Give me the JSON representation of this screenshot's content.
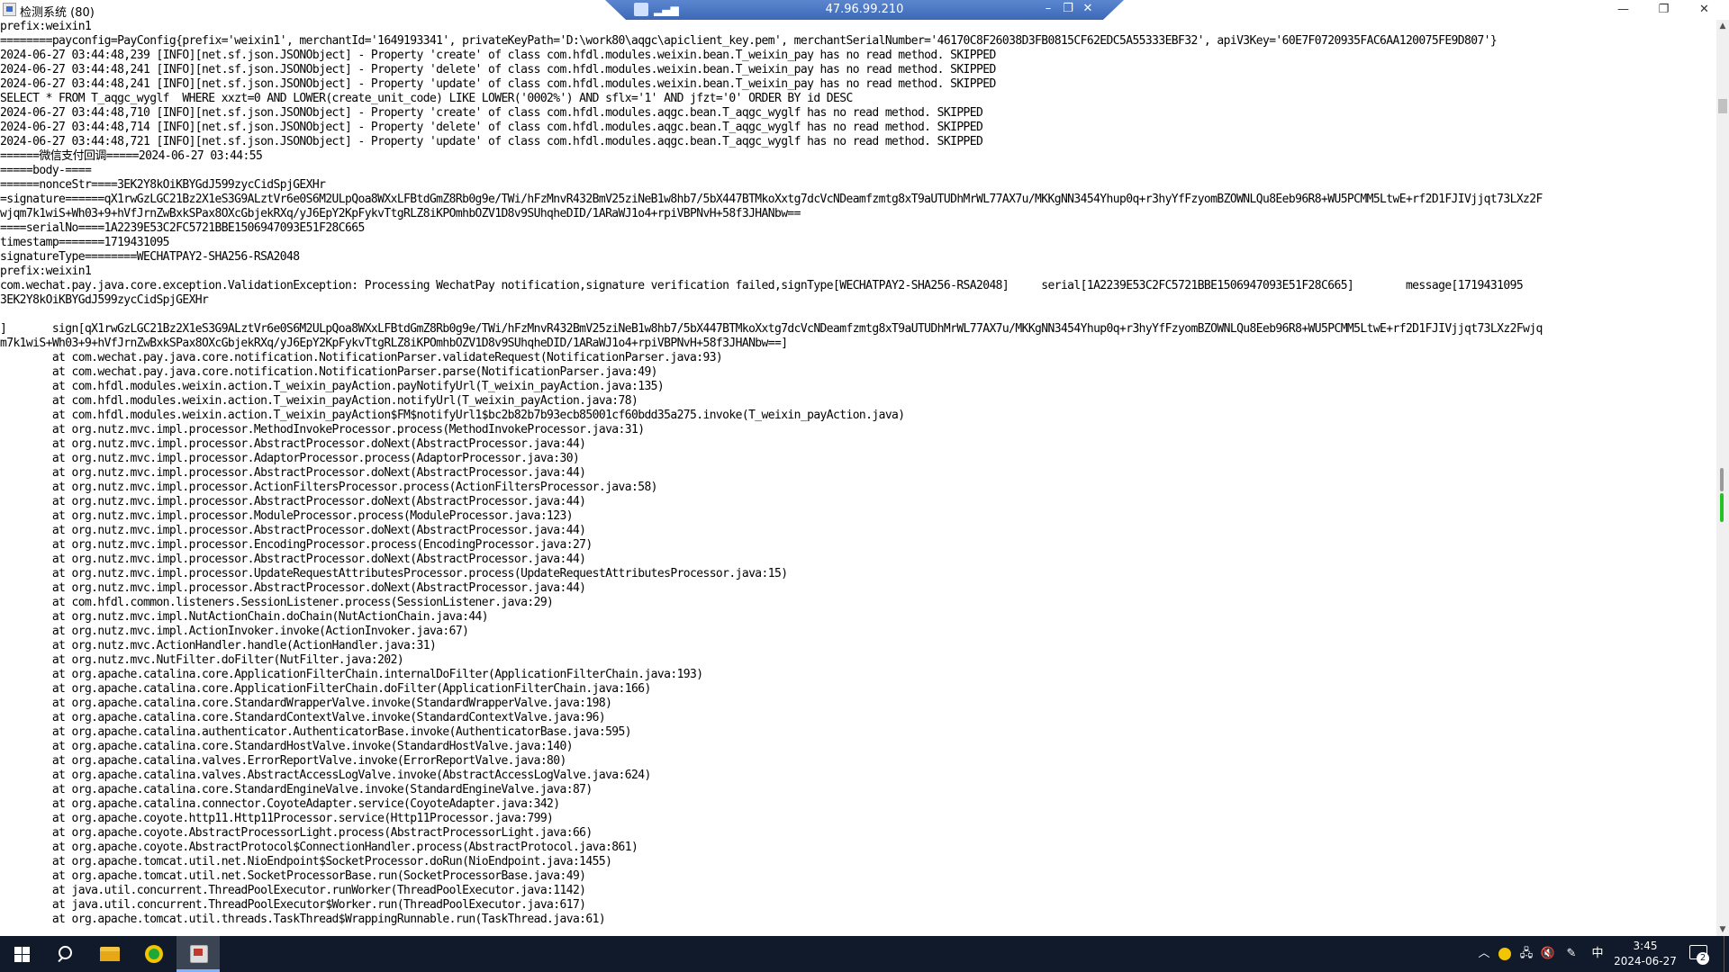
{
  "window": {
    "title": "检测系统 (80)",
    "minimize_icon": "minimize-icon",
    "maximize_icon": "restore-icon",
    "close_icon": "close-icon",
    "minimize_glyph": "—",
    "restore_glyph": "❐",
    "close_glyph": "✕"
  },
  "remote_bar": {
    "host": "47.96.99.210",
    "signal_glyph": "▂▄▆",
    "minimize_glyph": "–",
    "restore_glyph": "❐",
    "close_glyph": "✕"
  },
  "console": {
    "lines": [
      "prefix:weixin1",
      "========payconfig=PayConfig{prefix='weixin1', merchantId='1649193341', privateKeyPath='D:\\work80\\aqgc\\apiclient_key.pem', merchantSerialNumber='46170C8F26038D3FB0815CF62EDC5A55333EBF32', apiV3Key='60E7F0720935FAC6AA120075FE9D807'}",
      "2024-06-27 03:44:48,239 [INFO][net.sf.json.JSONObject] - Property 'create' of class com.hfdl.modules.weixin.bean.T_weixin_pay has no read method. SKIPPED",
      "2024-06-27 03:44:48,241 [INFO][net.sf.json.JSONObject] - Property 'delete' of class com.hfdl.modules.weixin.bean.T_weixin_pay has no read method. SKIPPED",
      "2024-06-27 03:44:48,241 [INFO][net.sf.json.JSONObject] - Property 'update' of class com.hfdl.modules.weixin.bean.T_weixin_pay has no read method. SKIPPED",
      "SELECT * FROM T_aqgc_wyglf  WHERE xxzt=0 AND LOWER(create_unit_code) LIKE LOWER('0002%') AND sflx='1' AND jfzt='0' ORDER BY id DESC",
      "2024-06-27 03:44:48,710 [INFO][net.sf.json.JSONObject] - Property 'create' of class com.hfdl.modules.aqgc.bean.T_aqgc_wyglf has no read method. SKIPPED",
      "2024-06-27 03:44:48,714 [INFO][net.sf.json.JSONObject] - Property 'delete' of class com.hfdl.modules.aqgc.bean.T_aqgc_wyglf has no read method. SKIPPED",
      "2024-06-27 03:44:48,721 [INFO][net.sf.json.JSONObject] - Property 'update' of class com.hfdl.modules.aqgc.bean.T_aqgc_wyglf has no read method. SKIPPED",
      "======微信支付回调=====2024-06-27 03:44:55",
      "=====body-====",
      "======nonceStr====3EK2Y8kOiKBYGdJ599zycCidSpjGEXHr",
      "=signature======qX1rwGzLGC21Bz2X1eS3G9ALztVr6e0S6M2ULpQoa8WXxLFBtdGmZ8Rb0g9e/TWi/hFzMnvR432BmV25ziNeB1w8hb7/5bX447BTMkoXxtg7dcVcNDeamfzmtg8xT9aUTUDhMrWL77AX7u/MKKgNN3454Yhup0q+r3hyYfFzyomBZOWNLQu8Eeb96R8+WU5PCMM5LtwE+rf2D1FJIVjjqt73LXz2F",
      "wjqm7k1wiS+Wh03+9+hVfJrnZwBxkSPax8OXcGbjekRXq/yJ6EpY2KpFykvTtgRLZ8iKPOmhbOZV1D8v9SUhqheDID/1ARaWJ1o4+rpiVBPNvH+58f3JHANbw==",
      "====serialNo====1A2239E53C2FC5721BBE1506947093E51F28C665",
      "timestamp=======1719431095",
      "signatureType========WECHATPAY2-SHA256-RSA2048",
      "prefix:weixin1",
      "com.wechat.pay.java.core.exception.ValidationException: Processing WechatPay notification,signature verification failed,signType[WECHATPAY2-SHA256-RSA2048]     serial[1A2239E53C2FC5721BBE1506947093E51F28C665]        message[1719431095",
      "3EK2Y8kOiKBYGdJ599zycCidSpjGEXHr",
      "",
      "]       sign[qX1rwGzLGC21Bz2X1eS3G9ALztVr6e0S6M2ULpQoa8WXxLFBtdGmZ8Rb0g9e/TWi/hFzMnvR432BmV25ziNeB1w8hb7/5bX447BTMkoXxtg7dcVcNDeamfzmtg8xT9aUTUDhMrWL77AX7u/MKKgNN3454Yhup0q+r3hyYfFzyomBZOWNLQu8Eeb96R8+WU5PCMM5LtwE+rf2D1FJIVjjqt73LXz2Fwjq",
      "m7k1wiS+Wh03+9+hVfJrnZwBxkSPax8OXcGbjekRXq/yJ6EpY2KpFykvTtgRLZ8iKPOmhbOZV1D8v9SUhqheDID/1ARaWJ1o4+rpiVBPNvH+58f3JHANbw==]",
      "        at com.wechat.pay.java.core.notification.NotificationParser.validateRequest(NotificationParser.java:93)",
      "        at com.wechat.pay.java.core.notification.NotificationParser.parse(NotificationParser.java:49)",
      "        at com.hfdl.modules.weixin.action.T_weixin_payAction.payNotifyUrl(T_weixin_payAction.java:135)",
      "        at com.hfdl.modules.weixin.action.T_weixin_payAction.notifyUrl(T_weixin_payAction.java:78)",
      "        at com.hfdl.modules.weixin.action.T_weixin_payAction$FM$notifyUrl1$bc2b82b7b93ecb85001cf60bdd35a275.invoke(T_weixin_payAction.java)",
      "        at org.nutz.mvc.impl.processor.MethodInvokeProcessor.process(MethodInvokeProcessor.java:31)",
      "        at org.nutz.mvc.impl.processor.AbstractProcessor.doNext(AbstractProcessor.java:44)",
      "        at org.nutz.mvc.impl.processor.AdaptorProcessor.process(AdaptorProcessor.java:30)",
      "        at org.nutz.mvc.impl.processor.AbstractProcessor.doNext(AbstractProcessor.java:44)",
      "        at org.nutz.mvc.impl.processor.ActionFiltersProcessor.process(ActionFiltersProcessor.java:58)",
      "        at org.nutz.mvc.impl.processor.AbstractProcessor.doNext(AbstractProcessor.java:44)",
      "        at org.nutz.mvc.impl.processor.ModuleProcessor.process(ModuleProcessor.java:123)",
      "        at org.nutz.mvc.impl.processor.AbstractProcessor.doNext(AbstractProcessor.java:44)",
      "        at org.nutz.mvc.impl.processor.EncodingProcessor.process(EncodingProcessor.java:27)",
      "        at org.nutz.mvc.impl.processor.AbstractProcessor.doNext(AbstractProcessor.java:44)",
      "        at org.nutz.mvc.impl.processor.UpdateRequestAttributesProcessor.process(UpdateRequestAttributesProcessor.java:15)",
      "        at org.nutz.mvc.impl.processor.AbstractProcessor.doNext(AbstractProcessor.java:44)",
      "        at com.hfdl.common.listeners.SessionListener.process(SessionListener.java:29)",
      "        at org.nutz.mvc.impl.NutActionChain.doChain(NutActionChain.java:44)",
      "        at org.nutz.mvc.impl.ActionInvoker.invoke(ActionInvoker.java:67)",
      "        at org.nutz.mvc.ActionHandler.handle(ActionHandler.java:31)",
      "        at org.nutz.mvc.NutFilter.doFilter(NutFilter.java:202)",
      "        at org.apache.catalina.core.ApplicationFilterChain.internalDoFilter(ApplicationFilterChain.java:193)",
      "        at org.apache.catalina.core.ApplicationFilterChain.doFilter(ApplicationFilterChain.java:166)",
      "        at org.apache.catalina.core.StandardWrapperValve.invoke(StandardWrapperValve.java:198)",
      "        at org.apache.catalina.core.StandardContextValve.invoke(StandardContextValve.java:96)",
      "        at org.apache.catalina.authenticator.AuthenticatorBase.invoke(AuthenticatorBase.java:595)",
      "        at org.apache.catalina.core.StandardHostValve.invoke(StandardHostValve.java:140)",
      "        at org.apache.catalina.valves.ErrorReportValve.invoke(ErrorReportValve.java:80)",
      "        at org.apache.catalina.valves.AbstractAccessLogValve.invoke(AbstractAccessLogValve.java:624)",
      "        at org.apache.catalina.core.StandardEngineValve.invoke(StandardEngineValve.java:87)",
      "        at org.apache.catalina.connector.CoyoteAdapter.service(CoyoteAdapter.java:342)",
      "        at org.apache.coyote.http11.Http11Processor.service(Http11Processor.java:799)",
      "        at org.apache.coyote.AbstractProcessorLight.process(AbstractProcessorLight.java:66)",
      "        at org.apache.coyote.AbstractProtocol$ConnectionHandler.process(AbstractProtocol.java:861)",
      "        at org.apache.tomcat.util.net.NioEndpoint$SocketProcessor.doRun(NioEndpoint.java:1455)",
      "        at org.apache.tomcat.util.net.SocketProcessorBase.run(SocketProcessorBase.java:49)",
      "        at java.util.concurrent.ThreadPoolExecutor.runWorker(ThreadPoolExecutor.java:1142)",
      "        at java.util.concurrent.ThreadPoolExecutor$Worker.run(ThreadPoolExecutor.java:617)",
      "        at org.apache.tomcat.util.threads.TaskThread$WrappingRunnable.run(TaskThread.java:61)"
    ]
  },
  "scrollbar": {
    "up_glyph": "▲",
    "down_glyph": "▼"
  },
  "taskbar": {
    "tray_chevron": "︿",
    "input_method": "中",
    "time": "3:45",
    "date": "2024-06-27",
    "notification_count": "2",
    "network_glyph": "🖧",
    "volume_glyph": "🔇",
    "pen_glyph": "✎"
  }
}
